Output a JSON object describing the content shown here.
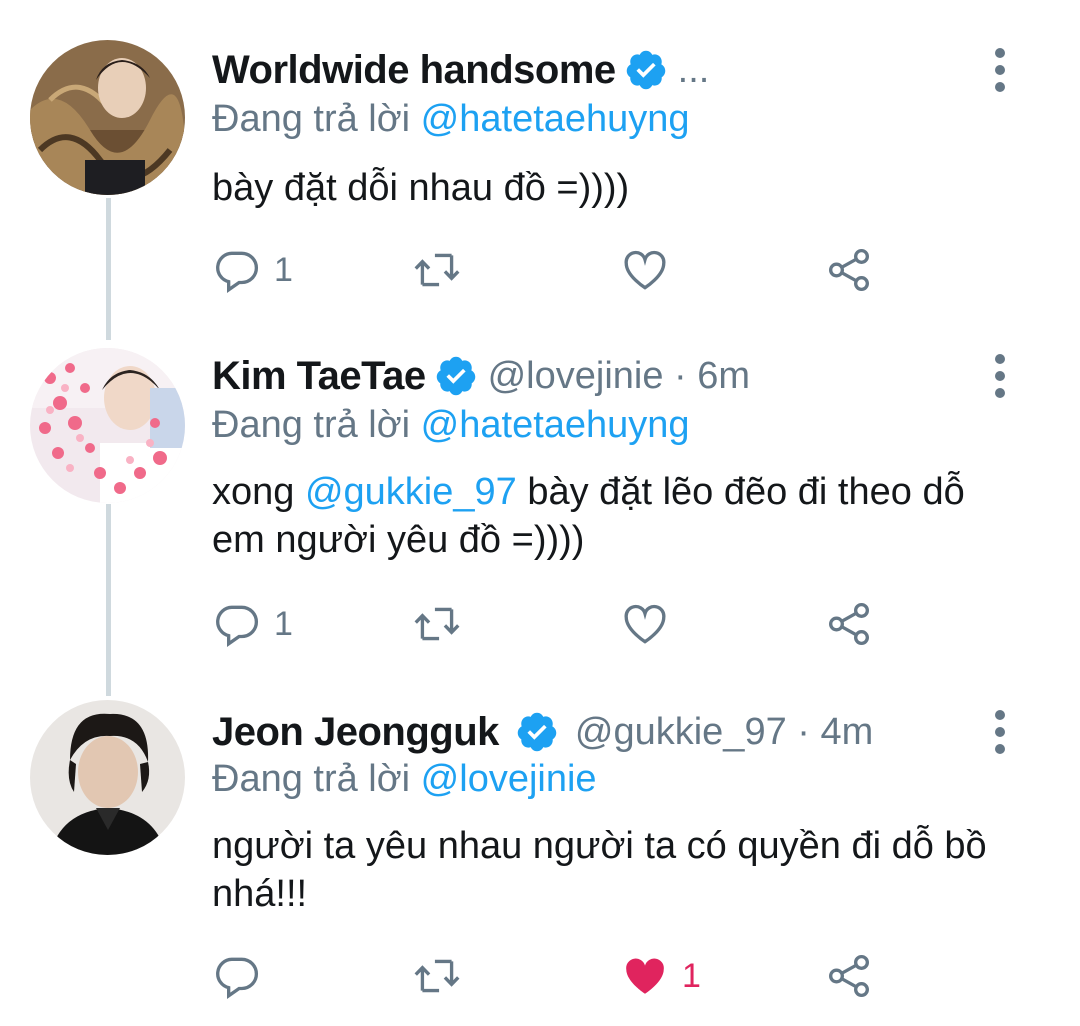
{
  "colors": {
    "accent": "#1da1f2",
    "secondary_text": "#657786",
    "like": "#e0245e",
    "thread_line": "#cfd9de"
  },
  "tweets": [
    {
      "name": "Worldwide handsome",
      "handle": "...",
      "time": "",
      "replying_prefix": "Đang trả lời",
      "replying_to": "@hatetaehuyng",
      "text_before": "bày đặt dỗi nhau đồ =))))",
      "text_mention": "",
      "text_after": "",
      "reply_count": "1",
      "retweet_count": "",
      "like_count": "",
      "liked": false
    },
    {
      "name": "Kim TaeTae",
      "handle": "@lovejinie · 6m",
      "replying_prefix": "Đang trả lời",
      "replying_to": "@hatetaehuyng",
      "text_before": "xong ",
      "text_mention": "@gukkie_97",
      "text_after": " bày đặt lẽo đẽo đi theo dỗ em người yêu đồ =))))",
      "reply_count": "1",
      "retweet_count": "",
      "like_count": "",
      "liked": false
    },
    {
      "name": "Jeon Jeongguk",
      "handle": "@gukkie_97 · 4m",
      "replying_prefix": "Đang trả lời",
      "replying_to": "@lovejinie",
      "text_before": "người ta yêu nhau người ta có quyền đi dỗ bồ nhá!!!",
      "text_mention": "",
      "text_after": "",
      "reply_count": "",
      "retweet_count": "",
      "like_count": "1",
      "liked": true
    }
  ]
}
